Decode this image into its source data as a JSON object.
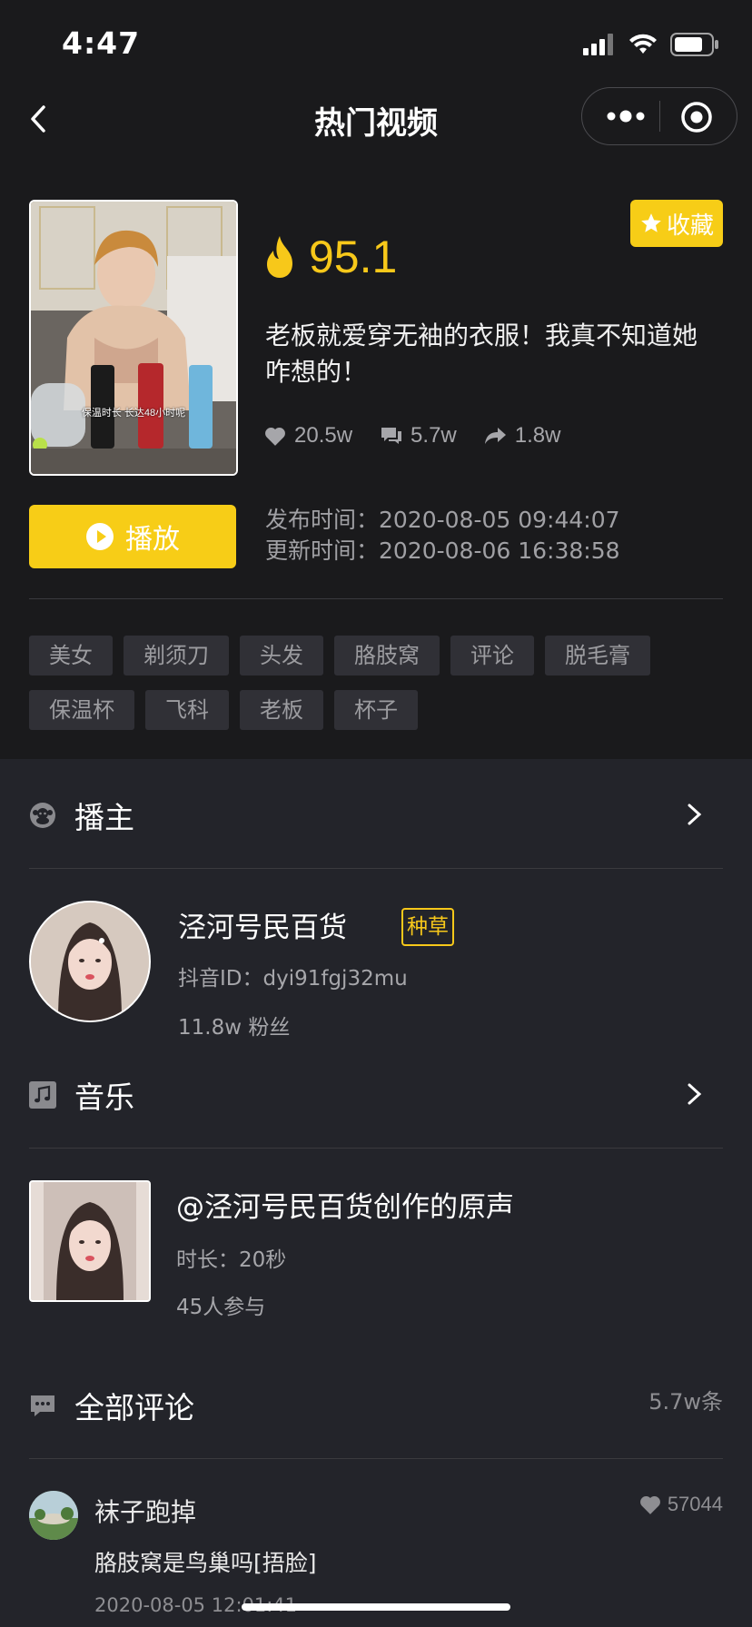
{
  "status": {
    "time": "4:47"
  },
  "nav": {
    "title": "热门视频"
  },
  "video": {
    "heat": "95.1",
    "favorite_label": "收藏",
    "title": "老板就爱穿无袖的衣服！我真不知道她咋想的！",
    "thumb_caption": "保温时长 长达48小时呢",
    "likes": "20.5w",
    "comments": "5.7w",
    "shares": "1.8w",
    "play_label": "播放",
    "publish_time": "发布时间：2020-08-05 09:44:07",
    "update_time": "更新时间：2020-08-06 16:38:58",
    "tags": [
      "美女",
      "剃须刀",
      "头发",
      "胳肢窝",
      "评论",
      "脱毛膏",
      "保温杯",
      "飞科",
      "老板",
      "杯子"
    ]
  },
  "anchor": {
    "section_label": "播主",
    "name": "泾河号民百货",
    "badge": "种草",
    "douyin_id": "抖音ID：dyi91fgj32mu",
    "fans": "11.8w 粉丝"
  },
  "music": {
    "section_label": "音乐",
    "title": "@泾河号民百货创作的原声",
    "duration": "时长：20秒",
    "participants": "45人参与"
  },
  "comments": {
    "section_label": "全部评论",
    "count": "5.7w条",
    "items": [
      {
        "user": "袜子跑掉",
        "likes": "57044",
        "text": "胳肢窝是鸟巢吗[捂脸]",
        "date": "2020-08-05 12:01:41"
      }
    ]
  },
  "colors": {
    "accent": "#f7cd17",
    "background": "#23242a",
    "card": "#1a1a1c"
  }
}
